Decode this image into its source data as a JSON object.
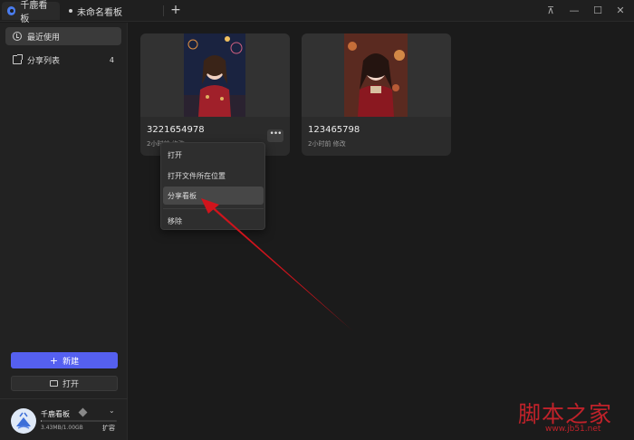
{
  "titlebar": {
    "tabs": [
      {
        "label": "千鹿看板"
      },
      {
        "label": "未命名看板"
      }
    ],
    "add_tab": "+",
    "pin": "⊼",
    "minimize": "—",
    "maximize": "☐",
    "close": "✕"
  },
  "sidebar": {
    "items": [
      {
        "label": "最近使用",
        "icon": "clock-icon"
      },
      {
        "label": "分享列表",
        "icon": "share-icon",
        "count": "4"
      }
    ],
    "new_button": {
      "label": "新建",
      "glyph": "+"
    },
    "open_button": {
      "label": "打开"
    },
    "account": {
      "name": "千鹿看板",
      "usage": "3.43MB/1.00GB",
      "usage_fraction": 0.0034,
      "expand": "扩容",
      "chevron": "⌄"
    }
  },
  "cards": [
    {
      "title": "3221654978",
      "subtitle": "2小时前 修改",
      "more": "•••"
    },
    {
      "title": "123465798",
      "subtitle": "2小时前 修改"
    }
  ],
  "context_menu": {
    "items": [
      {
        "label": "打开"
      },
      {
        "label": "打开文件所在位置"
      },
      {
        "label": "分享看板"
      },
      {
        "label": "移除"
      }
    ]
  },
  "annotation": {
    "arrow_color": "#d0141c"
  },
  "watermark": {
    "text": "脚本之家",
    "url": "www.jb51.net"
  },
  "colors": {
    "accent": "#5560f0",
    "background": "#1b1b1b"
  }
}
